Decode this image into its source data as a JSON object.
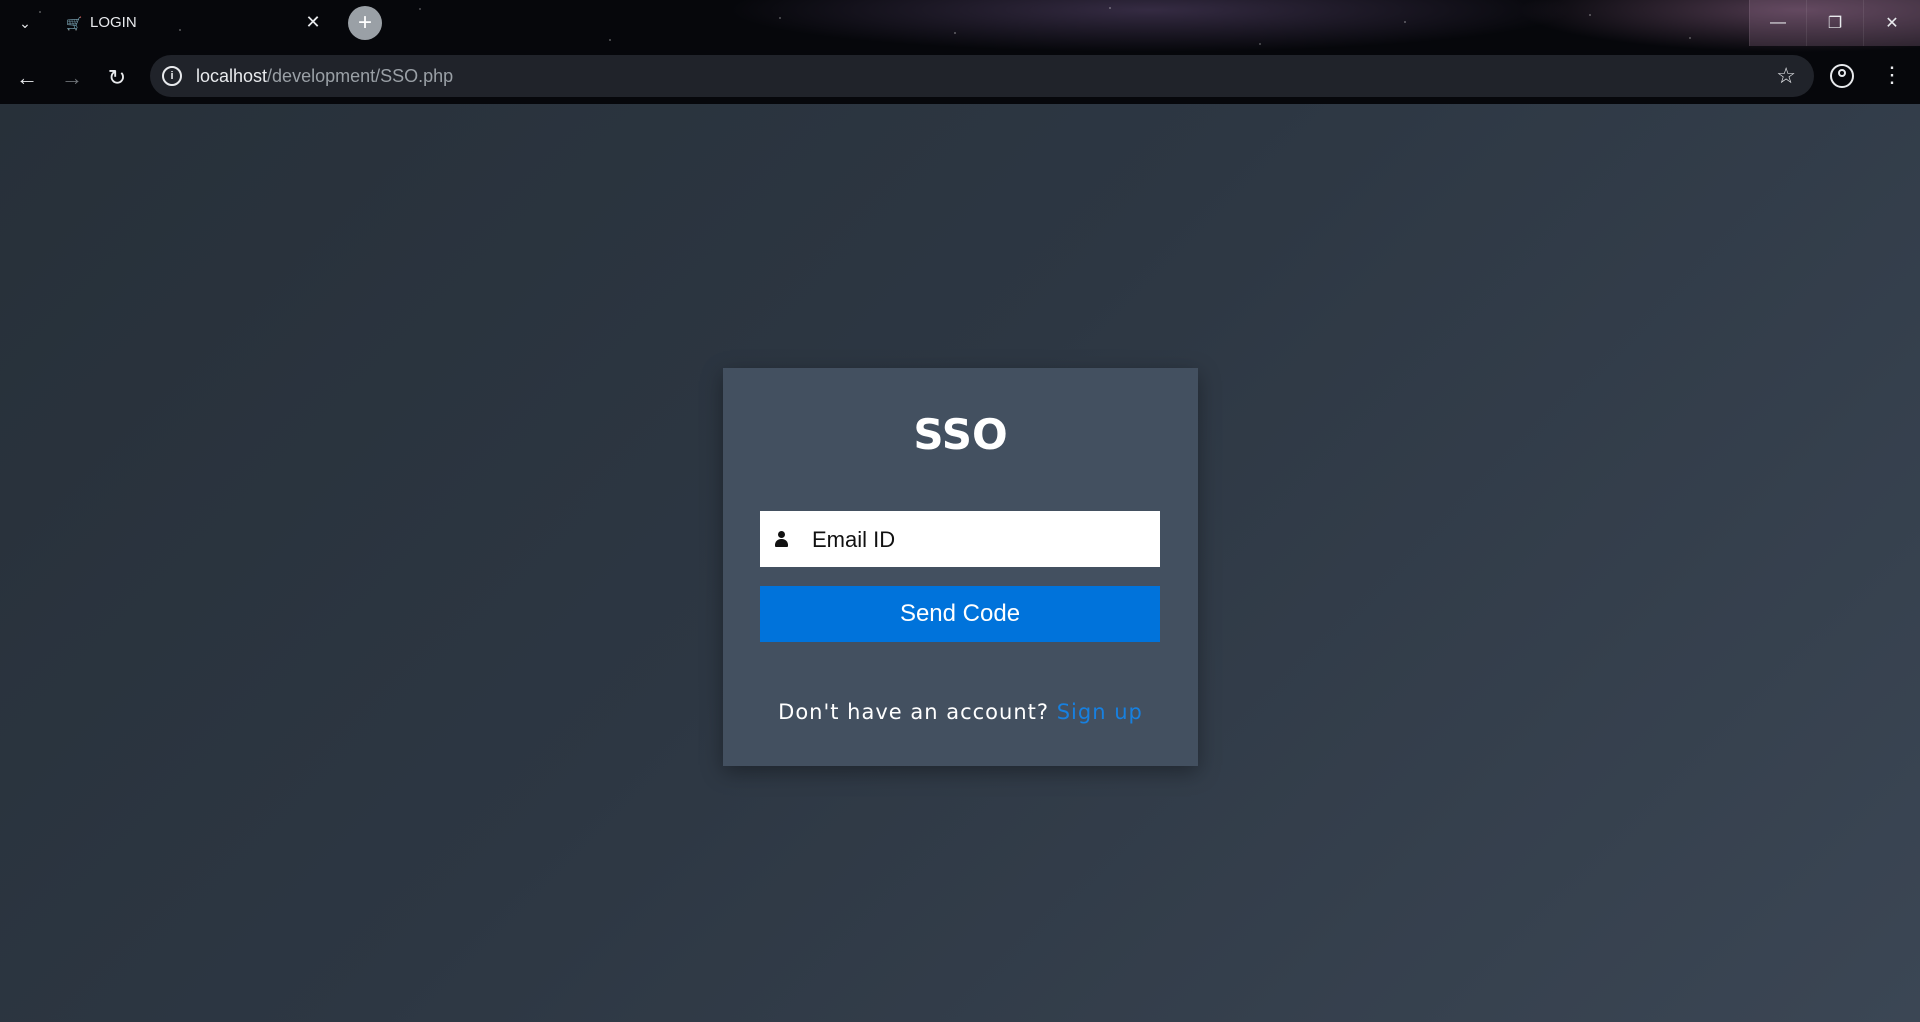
{
  "browser": {
    "tab": {
      "title": "LOGIN",
      "favicon": "cart-icon"
    },
    "new_tab_symbol": "+",
    "tab_close_symbol": "✕",
    "address": {
      "host": "localhost",
      "path": "/development/SSO.php"
    },
    "window_controls": {
      "minimize": "—",
      "restore": "❐",
      "close": "✕"
    }
  },
  "login": {
    "title": "SSO",
    "email_placeholder": "Email ID",
    "send_button": "Send Code",
    "signup_prompt": "Don't have an account?",
    "signup_link": "Sign up"
  },
  "colors": {
    "card_bg": "#435060",
    "button_bg": "#0073db",
    "link": "#1780e0",
    "page_bg": "#2d3743"
  }
}
